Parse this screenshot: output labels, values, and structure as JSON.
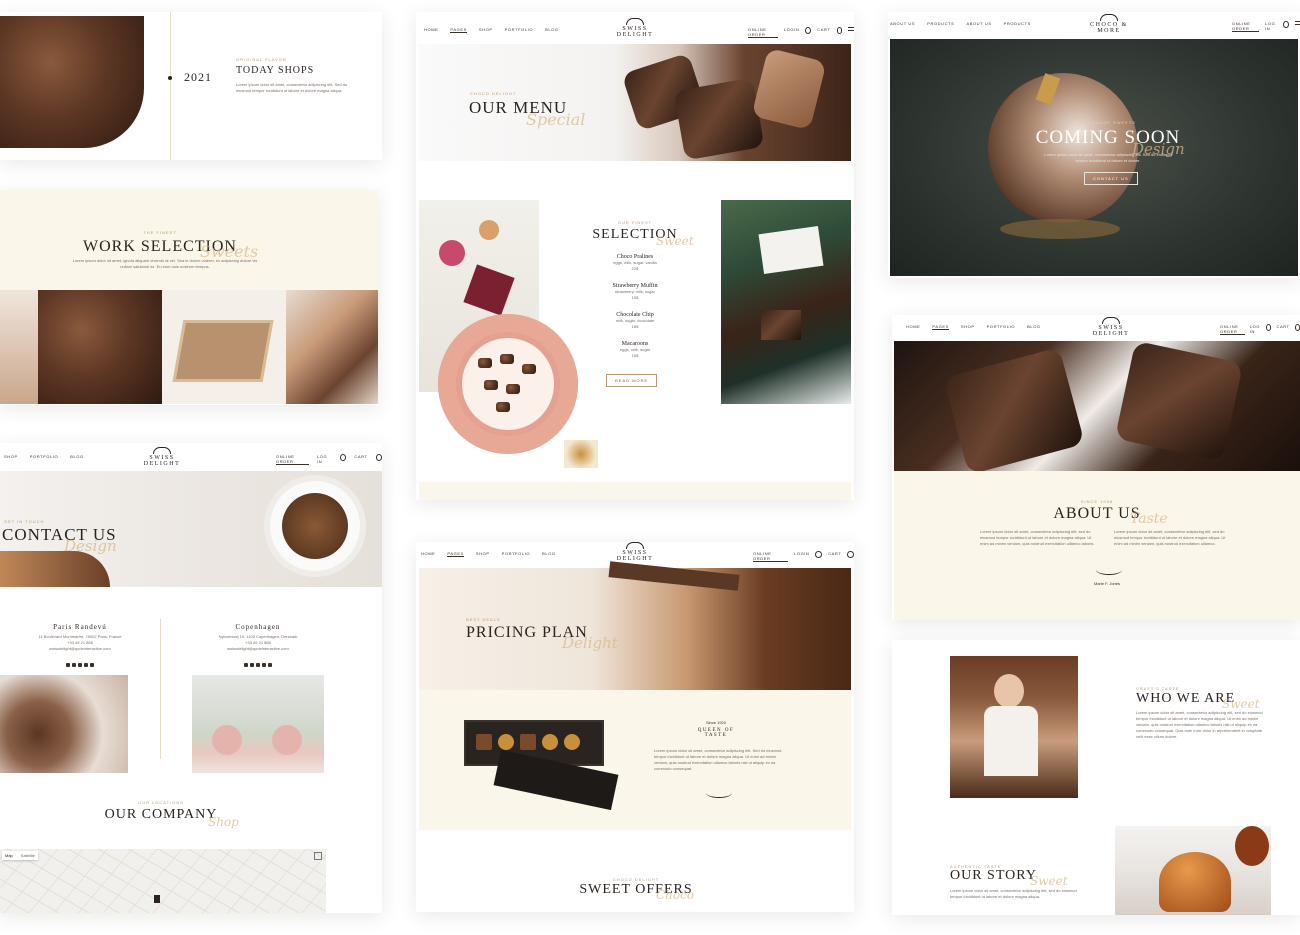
{
  "col1": {
    "history": {
      "year": "2021",
      "eyebrow": "ORIGINAL FLAVOR",
      "title": "TODAY SHOPS",
      "text": "Lorem ipsum dolor sit amet, consectetur adipiscing elit. Sed do eiusmod tempor incididunt ut labore et dolore magna aliqua."
    },
    "work": {
      "eyebrow": "THE FINEST",
      "title": "WORK SELECTION",
      "script": "Sweets",
      "text": "Lorem ipsum dolor sit amet, ignota aliquam vivendo at vel. Sea in dolore viderer, ex adipiscing dolore vis nullam salutandi ex. Eu eum duis nostrum tempus."
    },
    "contact": {
      "nav": [
        "SHOP",
        "PORTFOLIO",
        "BLOG"
      ],
      "logo": "SWISS DELIGHT",
      "online_order": "ONLINE ORDER",
      "login": "LOG IN",
      "cart": "CART",
      "eyebrow": "GET IN TOUCH",
      "title": "CONTACT US",
      "script": "Design",
      "locations": [
        {
          "city": "Paris Randevú",
          "address": "11 Boulevard Montmartre, 75002 Paris, France",
          "phone": "+33 49 21 888",
          "email": "swissdelight@qodeinteractive.com"
        },
        {
          "city": "Copenhagen",
          "address": "Nyboresvej 19, 1100 Copenhagen, Denmark",
          "phone": "+33 49 21 888",
          "email": "swissdelight@qodeinteractive.com"
        }
      ],
      "company_eyebrow": "OUR LOCATIONS",
      "company_title": "OUR COMPANY",
      "company_script": "Shop",
      "map_tab": "Map",
      "satellite_tab": "Satellite"
    }
  },
  "col2": {
    "header": {
      "nav": [
        "HOME",
        "PAGES",
        "SHOP",
        "PORTFOLIO",
        "BLOG"
      ],
      "logo": "SWISS DELIGHT",
      "online_order": "ONLINE ORDER",
      "login": "LOGIN",
      "cart": "CART"
    },
    "menu": {
      "eyebrow": "CHOCO DELIGHT",
      "title": "OUR MENU",
      "script": "Special"
    },
    "selection": {
      "eyebrow": "OUR FINEST",
      "title": "SELECTION",
      "script": "Sweet",
      "items": [
        {
          "name": "Choco Pralines",
          "desc": "eggs, milk, sugar, vanilla",
          "price": "22$"
        },
        {
          "name": "Strawberry Muffin",
          "desc": "strawberry, milk, sugar",
          "price": "15$"
        },
        {
          "name": "Chocolate Chip",
          "desc": "milk, sugar, chocolate",
          "price": "18$"
        },
        {
          "name": "Macaroons",
          "desc": "eggs, milk, sugar",
          "price": "15$"
        }
      ],
      "button": "READ MORE"
    },
    "pricing": {
      "eyebrow": "BEST DEALS",
      "title": "PRICING PLAN",
      "script": "Delight",
      "badge_since": "Since 1920",
      "badge_text": "QUEEN OF TASTE",
      "text": "Lorem ipsum dolor sit amet, consectetur adipiscing elit. Sed do eiusmod tempor incididunt ut labore et dolore magna aliqua. Ut enim ad minim veniam, quis nostrud exercitation ullamco laboris nisi ut aliquip ex ea commodo consequat."
    },
    "offers": {
      "eyebrow": "CHOCO DELIGHT",
      "title": "SWEET OFFERS",
      "script": "Choco"
    }
  },
  "col3": {
    "coming": {
      "nav": [
        "ABOUT US",
        "PRODUCTS",
        "ABOUT US",
        "PRODUCTS"
      ],
      "logo": "CHOCO & MORE",
      "online_order": "ONLINE ORDER",
      "login": "LOG IN",
      "eyebrow": "HANDMADE SWEETS",
      "title": "COMING SOON",
      "script": "Design",
      "text": "Lorem ipsum dolor sit amet, consectetur adipiscing elit. Sed do eiusmod tempor incididunt ut labore et dolore.",
      "button": "CONTACT US"
    },
    "about": {
      "nav": [
        "HOME",
        "PAGES",
        "SHOP",
        "PORTFOLIO",
        "BLOG"
      ],
      "logo": "SWISS DELIGHT",
      "online_order": "ONLINE ORDER",
      "login": "LOG IN",
      "cart": "CART",
      "eyebrow": "SINCE 1998",
      "title": "ABOUT US",
      "script": "Taste",
      "text_left": "Lorem ipsum dolor sit amet, consectetur adipiscing elit, sed do eiusmod tempor incididunt ut labore et dolore magna aliqua. Ut enim ad minim veniam, quis nostrud exercitation ullamco laboris.",
      "text_right": "Lorem ipsum dolor sit amet, consectetur adipiscing elit, sed do eiusmod tempor incididunt ut labore et dolore magna aliqua. Ut enim ad minim veniam, quis nostrud exercitation ullamco.",
      "signature_name": "Marie F. Jones"
    },
    "who": {
      "eyebrow": "CRAFT'S TASTE",
      "title": "WHO WE ARE",
      "script": "Sweet",
      "text": "Lorem ipsum dolor sit amet, consectetur adipiscing elit, sed do eiusmod tempor incididunt ut labore et dolore magna aliqua. Ut enim ad minim veniam, quis nostrud exercitation ullamco laboris nisi ut aliquip ex ea commodo consequat. Duis aute irure dolor in reprehenderit in voluptate velit esse cillum dolore."
    },
    "story": {
      "eyebrow": "AUTHENTIC TASTE",
      "title": "OUR STORY",
      "script": "Sweet",
      "text": "Lorem ipsum dolor sit amet, consectetur adipiscing elit, sed do eiusmod tempor incididunt ut labore et dolore magna aliqua."
    }
  }
}
